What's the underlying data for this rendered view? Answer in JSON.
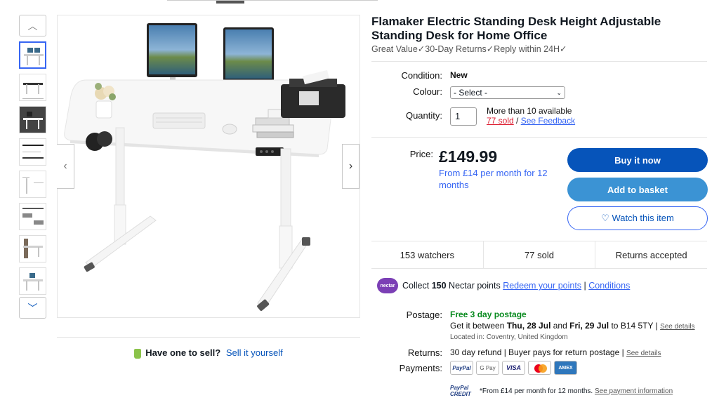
{
  "product": {
    "title": "Flamaker Electric Standing Desk Height Adjustable Standing Desk for Home Office",
    "subtitle": "Great Value✓30-Day Returns✓Reply within 24H✓"
  },
  "details": {
    "condition_label": "Condition:",
    "condition_value": "New",
    "colour_label": "Colour:",
    "colour_value": "- Select -",
    "quantity_label": "Quantity:",
    "quantity_value": "1",
    "availability": "More than 10 available",
    "sold_link": "77 sold",
    "separator": " / ",
    "feedback_link": "See Feedback"
  },
  "pricing": {
    "price_label": "Price:",
    "price": "£149.99",
    "finance": "From £14 per month for 12 months"
  },
  "actions": {
    "buy_now": "Buy it now",
    "add_to_basket": "Add to basket",
    "watch": "♡ Watch this item"
  },
  "stats": {
    "watchers": "153 watchers",
    "sold": "77 sold",
    "returns": "Returns accepted"
  },
  "nectar": {
    "logo": "nectar",
    "text_prefix": "Collect ",
    "points": "150",
    "text_suffix": " Nectar points ",
    "redeem_link": "Redeem your points",
    "divider": " | ",
    "conditions_link": "Conditions"
  },
  "postage": {
    "label": "Postage:",
    "free": "Free 3 day postage",
    "get_it": "Get it between ",
    "date1": "Thu, 28 Jul",
    "and": " and ",
    "date2": "Fri, 29 Jul",
    "to": " to B14 5TY | ",
    "see_details": "See details",
    "located": "Located in: Coventry, United Kingdom"
  },
  "returns": {
    "label": "Returns:",
    "text": "30 day refund | Buyer pays for return postage | ",
    "see_details": "See details"
  },
  "payments": {
    "label": "Payments:",
    "cards": [
      "PayPal",
      "G Pay",
      "VISA",
      "",
      "AMEX"
    ],
    "paypal_credit_logo": "PayPal CREDIT",
    "credit_text": "*From £14 per month for 12 months. ",
    "credit_link": "See payment information"
  },
  "sell": {
    "question": "Have one to sell?",
    "link": "Sell it yourself"
  },
  "colors": {
    "buy_button": "#0654ba",
    "basket_button": "#3b93d4",
    "link": "#3665f3",
    "sold_red": "#dd1e31",
    "free_green": "#078a1e",
    "nectar_purple": "#7b3fb5"
  },
  "icons": {
    "thumb_up": "chevron-up-icon",
    "thumb_down": "chevron-down-icon",
    "prev": "chevron-left-icon",
    "next": "chevron-right-icon",
    "select_caret": "chevron-down-icon"
  }
}
